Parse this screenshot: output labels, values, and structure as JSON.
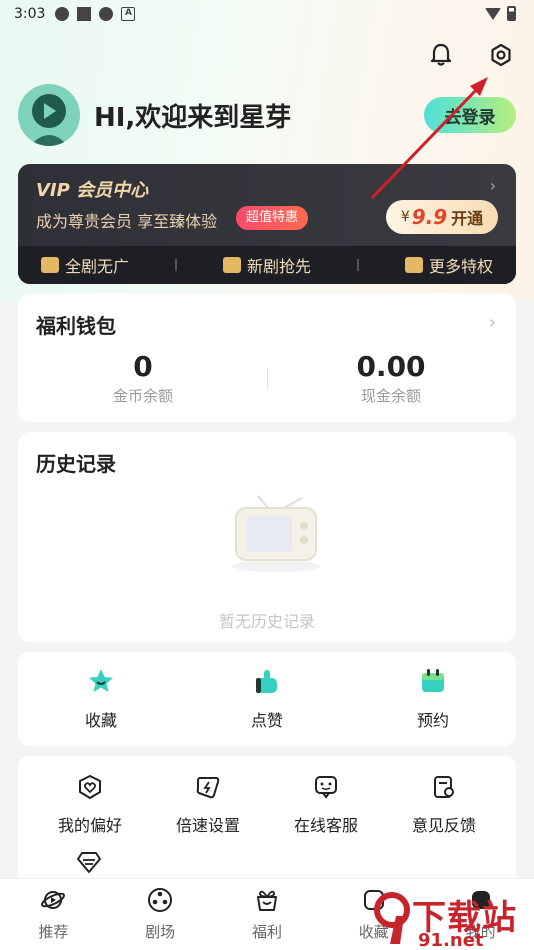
{
  "status": {
    "time": "3:03"
  },
  "profile": {
    "greeting": "HI,欢迎来到星芽",
    "login_label": "去登录"
  },
  "vip": {
    "title": "VIP 会员中心",
    "subtitle": "成为尊贵会员 享至臻体验",
    "badge": "超值特惠",
    "currency": "¥",
    "price": "9.9",
    "open_label": "开通",
    "perks": [
      "全剧无广",
      "新剧抢先",
      "更多特权"
    ]
  },
  "wallet": {
    "title": "福利钱包",
    "coins_value": "0",
    "coins_label": "金币余额",
    "cash_value": "0.00",
    "cash_label": "现金余额"
  },
  "history": {
    "title": "历史记录",
    "empty_text": "暂无历史记录"
  },
  "actions": [
    "收藏",
    "点赞",
    "预约"
  ],
  "settings": [
    "我的偏好",
    "倍速设置",
    "在线客服",
    "意见反馈"
  ],
  "nav": [
    "推荐",
    "剧场",
    "福利",
    "收藏",
    "我的"
  ],
  "watermark": {
    "main": "下载站",
    "sub": "91.net"
  },
  "colors": {
    "accent": "#4fe0d9",
    "vip_dark": "#2f3037",
    "badge_red": "#ff4b6d",
    "arrow_red": "#d0202a"
  }
}
